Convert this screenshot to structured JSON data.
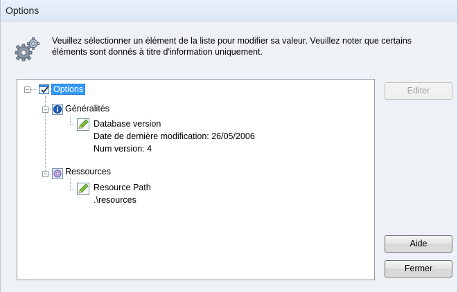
{
  "window": {
    "title": "Options"
  },
  "intro": {
    "icon": "gears-icon",
    "text": "Veuillez sélectionner un élément de la liste pour modifier sa valeur. Veuillez noter que certains éléments sont donnés à titre d'information uniquement."
  },
  "tree": {
    "root": {
      "label": "Options",
      "icon": "checkbox-window-icon",
      "selected": true
    },
    "general": {
      "label": "Généralités",
      "icon": "info-icon",
      "item": {
        "label": "Database version",
        "icon": "edit-document-icon",
        "details": [
          "Date de dernière modification: 26/05/2006",
          "Num version: 4"
        ]
      }
    },
    "resources": {
      "label": "Ressources",
      "icon": "resources-icon",
      "item": {
        "label": "Resource Path",
        "icon": "edit-document-icon",
        "value": ".\\resources"
      }
    }
  },
  "buttons": {
    "edit": "Editer",
    "help": "Aide",
    "close": "Fermer"
  },
  "colors": {
    "selection": "#3399ff",
    "window_background": "#eef2f6"
  }
}
